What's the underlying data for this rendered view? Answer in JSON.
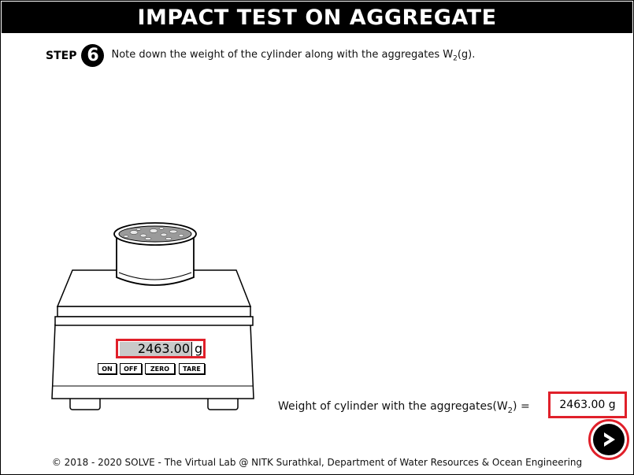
{
  "header": {
    "title": "IMPACT TEST ON AGGREGATE"
  },
  "step": {
    "label": "STEP",
    "number": "6",
    "text_before_sub": "Note down the weight of the cylinder along with the aggregates W",
    "sub": "2",
    "text_after_sub": "(g)."
  },
  "balance": {
    "display_value": "2463.00",
    "unit": "g",
    "buttons": {
      "on": "ON",
      "off": "OFF",
      "zero": "ZERO",
      "tare": "TARE"
    }
  },
  "result": {
    "label_before_sub": "Weight of cylinder with the aggregates(W",
    "sub": "2",
    "label_after_sub": ") =",
    "value": "2463.00 g"
  },
  "footer": {
    "text": "© 2018 - 2020 SOLVE - The Virtual Lab @ NITK Surathkal, Department of Water Resources & Ocean Engineering"
  },
  "colors": {
    "highlight": "#e0202a",
    "display_bg": "#c9c9c9"
  },
  "icons": {
    "next": "chevron-right-circle-icon"
  }
}
